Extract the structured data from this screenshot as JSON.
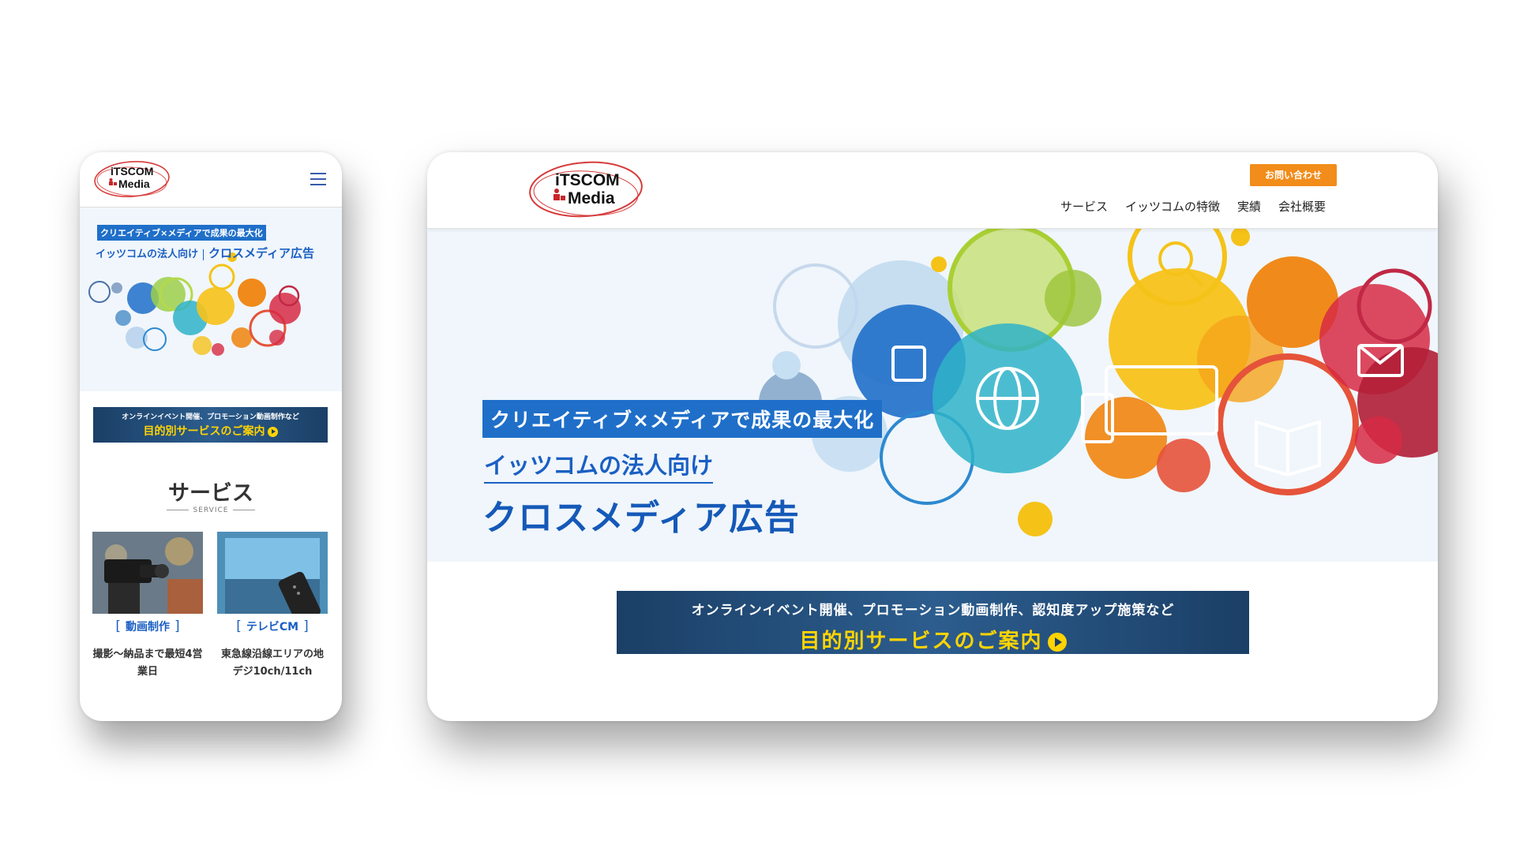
{
  "brand": {
    "logo_line1": "iTSCOM",
    "logo_line2": "Media"
  },
  "desktop": {
    "contact_button": "お問い合わせ",
    "nav": [
      "サービス",
      "イッツコムの特徴",
      "実績",
      "会社概要"
    ],
    "hero": {
      "tagline": "クリエイティブ×メディアで成果の最大化",
      "subtitle": "イッツコムの法人向け",
      "title": "クロスメディア広告"
    },
    "banner": {
      "line1": "オンラインイベント開催、プロモーション動画制作、認知度アップ施策など",
      "line2": "目的別サービスのご案内"
    }
  },
  "phone": {
    "hero": {
      "tagline": "クリエイティブ×メディアで成果の最大化",
      "subtitle": "イッツコムの法人向け",
      "title": "クロスメディア広告"
    },
    "banner": {
      "line1": "オンラインイベント開催、プロモーション動画制作など",
      "line2": "目的別サービスのご案内"
    },
    "section": {
      "title": "サービス",
      "subtitle_en": "SERVICE"
    },
    "cards": [
      {
        "label": "動画制作",
        "desc": "撮影〜納品まで最短4営業日"
      },
      {
        "label": "テレビCM",
        "desc": "東急線沿線エリアの地デジ10ch/11ch"
      }
    ]
  },
  "colors": {
    "accent_blue": "#1f6fc9",
    "contact_orange": "#f28c1a",
    "banner_yellow": "#ffd400",
    "banner_navy": "#1b3f66"
  }
}
